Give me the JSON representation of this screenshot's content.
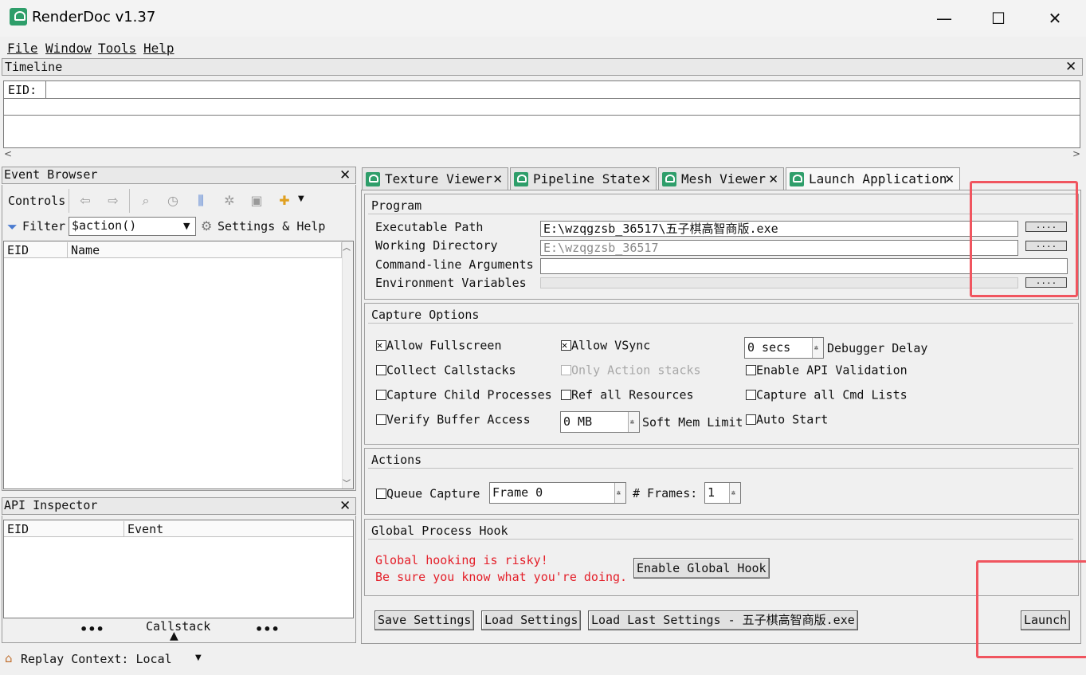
{
  "window": {
    "title": "RenderDoc v1.37",
    "minimize": "—",
    "maximize": "☐",
    "close": "✕"
  },
  "menu": [
    "File",
    "Window",
    "Tools",
    "Help"
  ],
  "timeline": {
    "title": "Timeline",
    "eid_label": "EID:"
  },
  "event_browser": {
    "title": "Event Browser",
    "controls_label": "Controls",
    "filter_label": "Filter",
    "filter_value": "$action()",
    "settings_label": "Settings & Help",
    "columns": [
      "EID",
      "Name"
    ]
  },
  "api_inspector": {
    "title": "API Inspector",
    "columns": [
      "EID",
      "Event"
    ],
    "callstack_label": "Callstack",
    "dots": "•••"
  },
  "status": {
    "replay_context": "Replay Context: Local"
  },
  "tabs": [
    {
      "label": "Texture Viewer"
    },
    {
      "label": "Pipeline State"
    },
    {
      "label": "Mesh Viewer"
    },
    {
      "label": "Launch Application"
    }
  ],
  "program": {
    "title": "Program",
    "executable_label": "Executable Path",
    "executable_value": "E:\\wzqgzsb_36517\\五子棋高智商版.exe",
    "working_dir_label": "Working Directory",
    "working_dir_value": "E:\\wzqgzsb_36517",
    "cmdline_label": "Command-line Arguments",
    "cmdline_value": "",
    "env_label": "Environment Variables",
    "browse": "...."
  },
  "capture_options": {
    "title": "Capture Options",
    "allow_fullscreen": "Allow Fullscreen",
    "allow_vsync": "Allow VSync",
    "debugger_delay_value": "0 secs",
    "debugger_delay_label": "Debugger Delay",
    "collect_callstacks": "Collect Callstacks",
    "only_action_stacks": "Only Action stacks",
    "enable_api_validation": "Enable API Validation",
    "capture_child": "Capture Child Processes",
    "ref_all_resources": "Ref all Resources",
    "capture_all_cmd": "Capture all Cmd Lists",
    "verify_buffer": "Verify Buffer Access",
    "soft_mem_value": "0 MB",
    "soft_mem_label": "Soft Mem Limit",
    "auto_start": "Auto Start"
  },
  "actions": {
    "title": "Actions",
    "queue_capture": "Queue Capture",
    "frame_value": "Frame 0",
    "frames_label": "# Frames:",
    "frames_value": "1"
  },
  "global_hook": {
    "title": "Global Process Hook",
    "warning1": "Global hooking is risky!",
    "warning2": "Be sure you know what you're doing.",
    "enable_button": "Enable Global Hook"
  },
  "bottom_buttons": {
    "save": "Save Settings",
    "load": "Load Settings",
    "load_last": "Load Last Settings - 五子棋高智商版.exe",
    "launch": "Launch"
  }
}
